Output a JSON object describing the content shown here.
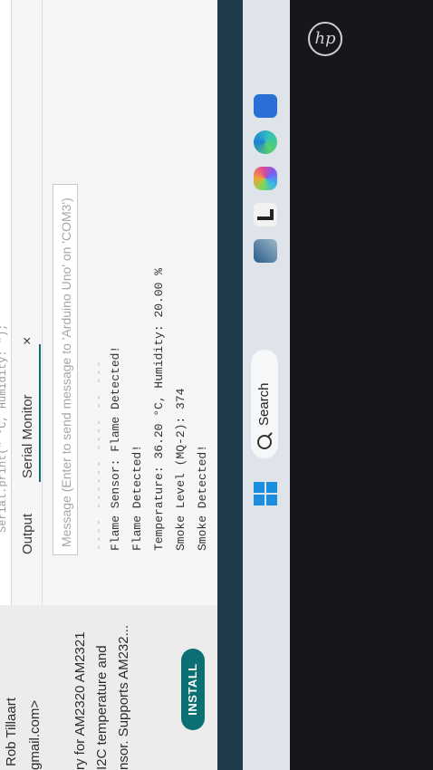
{
  "library_panel": {
    "author_line": "Rob Tillaart",
    "email_line": "gmail.com>",
    "desc_line_1": "ry for AM2320 AM2321",
    "desc_line_2": "I2C temperature and",
    "desc_line_3": "nsor. Supports AM232...",
    "install_label": "INSTALL"
  },
  "tabs": {
    "output_label": "Output",
    "serial_label": "Serial Monitor",
    "close_glyph": "×"
  },
  "serial_input": {
    "placeholder": "Message (Enter to send message to 'Arduino Uno' on 'COM3')"
  },
  "serial_output": {
    "lines": [
      "Flame Sensor: Flame Detected!",
      "Flame Detected!",
      "Temperature: 36.20 °C, Humidity: 20.00 %",
      "Smoke Level (MQ-2): 374",
      "Smoke Detected!"
    ]
  },
  "taskbar": {
    "search_label": "Search",
    "icons": [
      "windows-start-icon",
      "search-icon",
      "widgets-icon",
      "file-explorer-icon",
      "copilot-icon",
      "edge-icon",
      "store-icon"
    ]
  },
  "colors": {
    "accent": "#0b6f73",
    "taskbar": "#dfe3ea"
  }
}
